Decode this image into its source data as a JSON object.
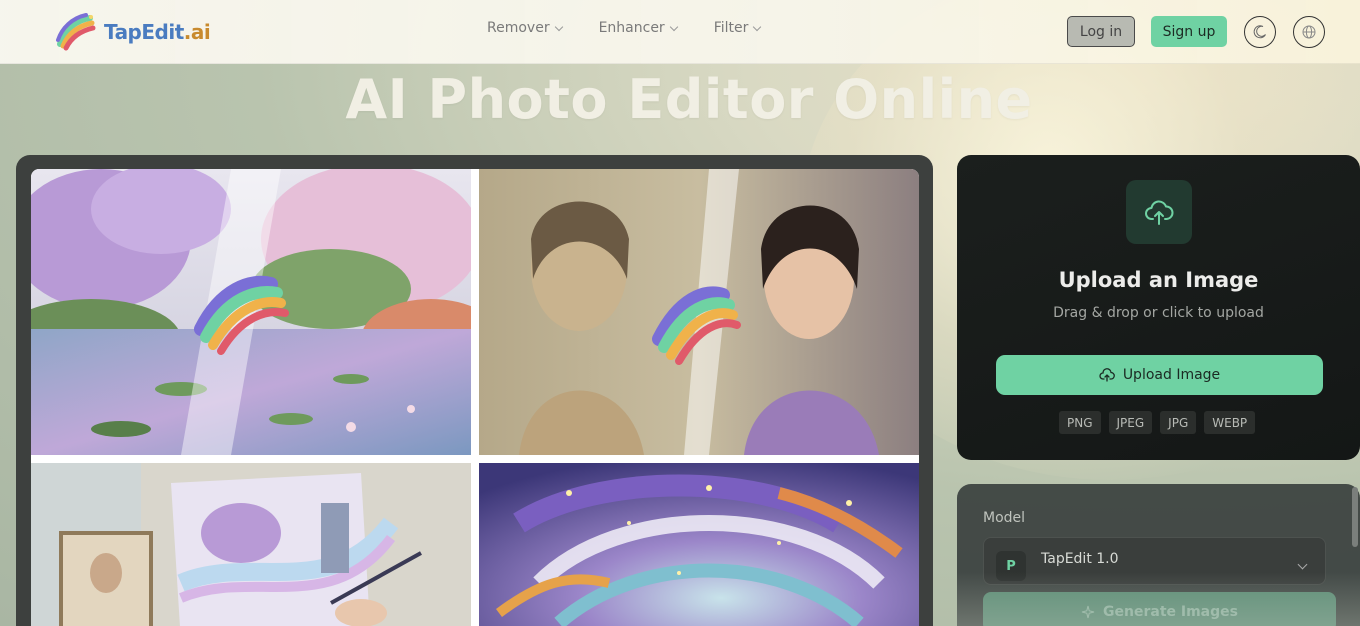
{
  "header": {
    "logo_text": "TapEdit",
    "logo_suffix": ".ai",
    "nav": [
      {
        "label": "Remover"
      },
      {
        "label": "Enhancer"
      },
      {
        "label": "Filter"
      }
    ],
    "login_label": "Log in",
    "signup_label": "Sign up",
    "theme_icon": "moon-icon",
    "language_icon": "globe-icon"
  },
  "page_title": "AI Photo Editor Online",
  "gallery": {
    "tiles": [
      {
        "subject": "painted lily pond garden"
      },
      {
        "subject": "sepia portrait turned colored painting"
      },
      {
        "subject": "artist painting on easel"
      },
      {
        "subject": "swirling galaxy impasto"
      }
    ]
  },
  "upload": {
    "icon": "cloud-upload-icon",
    "title": "Upload an Image",
    "subtitle": "Drag & drop or click to upload",
    "button_label": "Upload Image",
    "formats": [
      "PNG",
      "JPEG",
      "JPG",
      "WEBP"
    ]
  },
  "model": {
    "label": "Model",
    "avatar": "P",
    "selected": "TapEdit 1.0",
    "generate_label": "Generate Images"
  },
  "colors": {
    "accent": "#6fd2a3",
    "dark_panel": "#1b1f1d",
    "logo_blue": "#4a7cc0"
  }
}
